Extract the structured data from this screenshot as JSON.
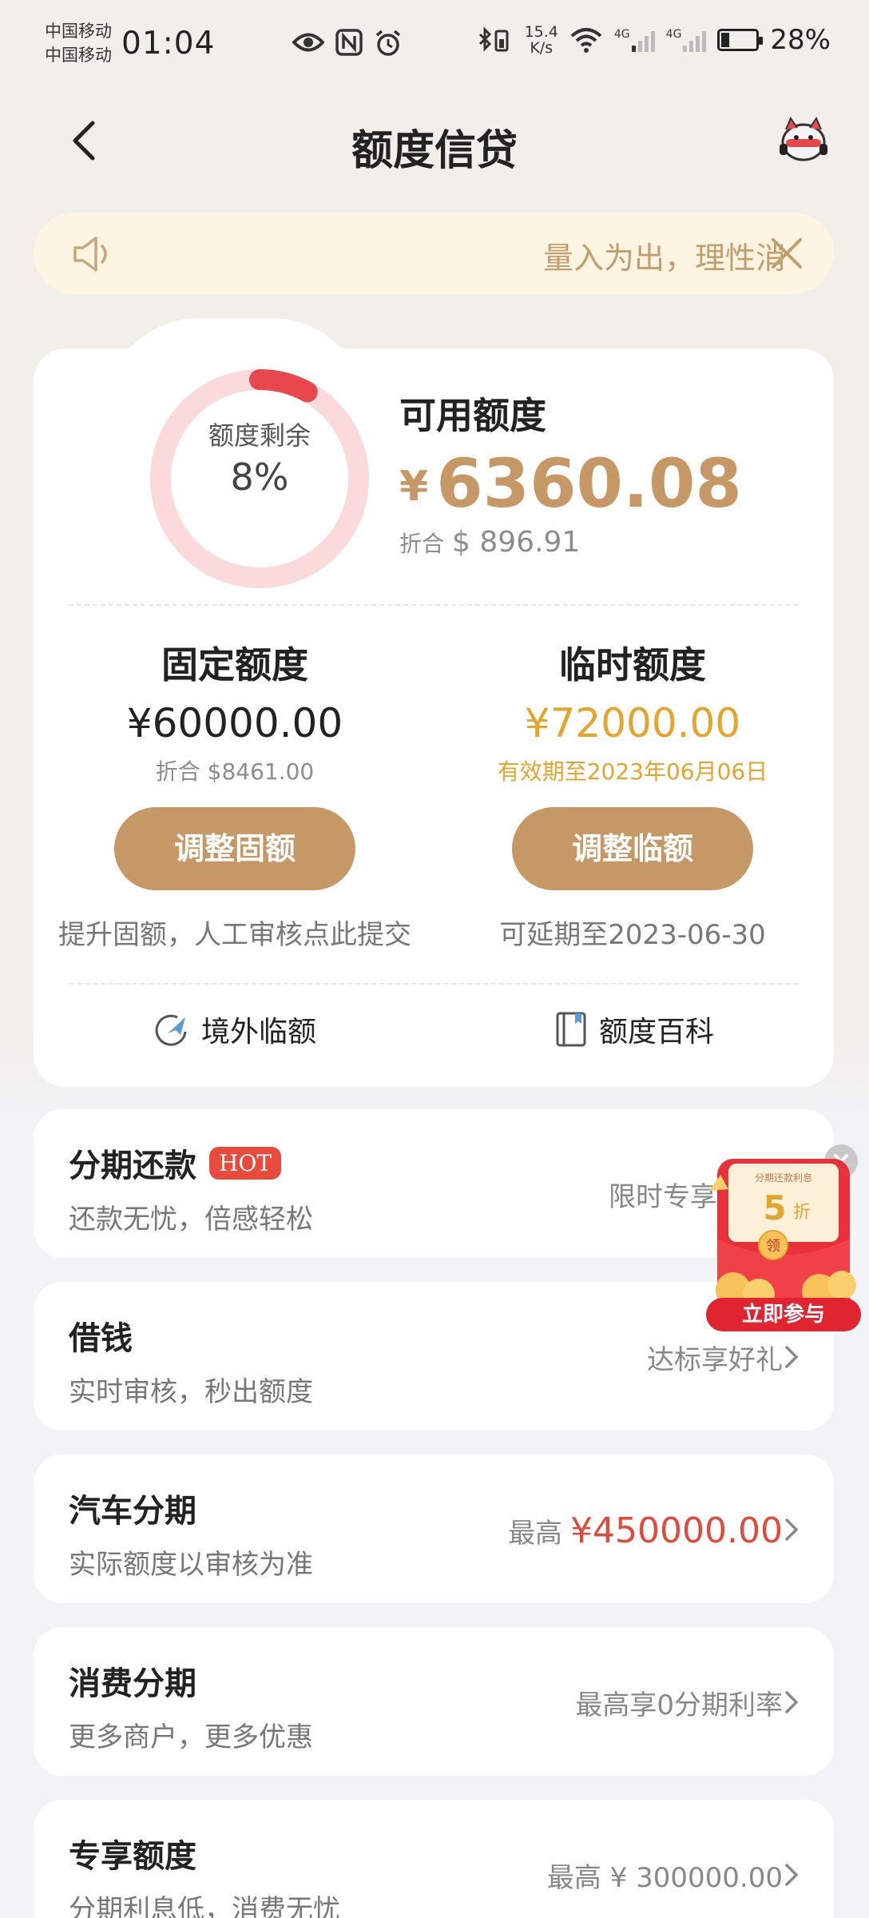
{
  "status": {
    "carrier1": "中国移动",
    "carrier2": "中国移动",
    "time": "01:04",
    "speed_value": "15.4",
    "speed_unit": "K/s",
    "net1": "4G",
    "net2": "4G",
    "battery": "28%"
  },
  "header": {
    "title": "额度信贷"
  },
  "notice": {
    "text": "量入为出，理性消费"
  },
  "credit": {
    "ring_label": "额度剩余",
    "ring_percent": "8%",
    "ring_fraction": 0.08,
    "available_label": "可用额度",
    "available_currency": "¥",
    "available_amount": "6360.08",
    "converted_prefix": "折合",
    "converted_amount": "$ 896.91",
    "fixed": {
      "label": "固定额度",
      "amount": "¥60000.00",
      "sub": "折合 $8461.00",
      "button": "调整固额",
      "hint": "提升固额，人工审核点此提交"
    },
    "temp": {
      "label": "临时额度",
      "amount": "¥72000.00",
      "sub": "有效期至2023年06月06日",
      "button": "调整临额",
      "hint": "可延期至2023-06-30"
    },
    "links": [
      "境外临额",
      "额度百科"
    ]
  },
  "items": [
    {
      "name": "分期还款",
      "badge": "HOT",
      "desc": "还款无忧，倍感轻松",
      "right_prefix": "限时专享",
      "right_highlight": "5折"
    },
    {
      "name": "借钱",
      "desc": "实时审核，秒出额度",
      "right_prefix": "达标享好礼"
    },
    {
      "name": "汽车分期",
      "desc": "实际额度以审核为准",
      "right_prefix": "最高",
      "right_highlight": "¥450000.00"
    },
    {
      "name": "消费分期",
      "desc": "更多商户，更多优惠",
      "right_prefix": "最高享0分期利率"
    },
    {
      "name": "专享额度",
      "desc": "分期利息低，消费无忧",
      "right_prefix": "最高 ¥ 300000.00"
    }
  ],
  "promo": {
    "top_text": "分期还款利息",
    "discount": "5",
    "discount_unit": "折",
    "coin_text": "领",
    "button": "立即参与"
  },
  "colors": {
    "accent": "#c69865",
    "gold": "#e3a52b",
    "red": "#e04a3c",
    "ring": "#e8484d",
    "ring_track": "#fadadb"
  }
}
